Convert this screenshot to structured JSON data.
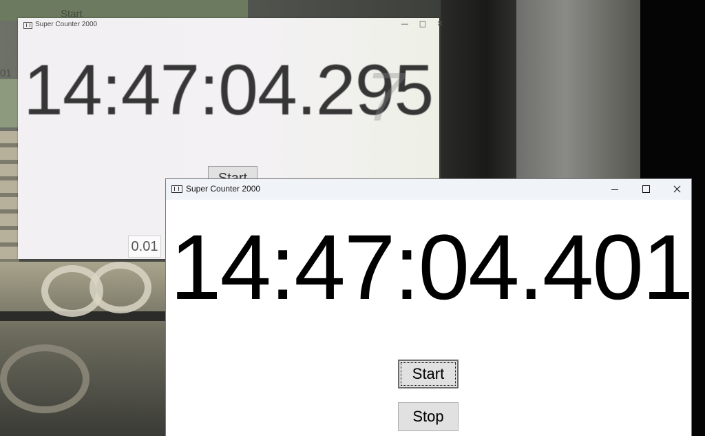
{
  "background_window": {
    "title": "Super Counter 2000",
    "controls": {
      "minimize": "—",
      "maximize": "□",
      "close": "✕"
    },
    "clock_text": "14:47:04.295",
    "ghost_digit": "7",
    "start_label": "Start",
    "number_value": "0.01"
  },
  "background_text": {
    "faint_start": "Start",
    "faint_number": "01"
  },
  "foreground_window": {
    "title": "Super Counter 2000",
    "clock_text": "14:47:04.401",
    "start_label": "Start",
    "stop_label": "Stop"
  },
  "colors": {
    "window_bg": "#ffffff",
    "button_bg": "#e1e1e1",
    "titlebar_bg": "#f0f4f9"
  }
}
